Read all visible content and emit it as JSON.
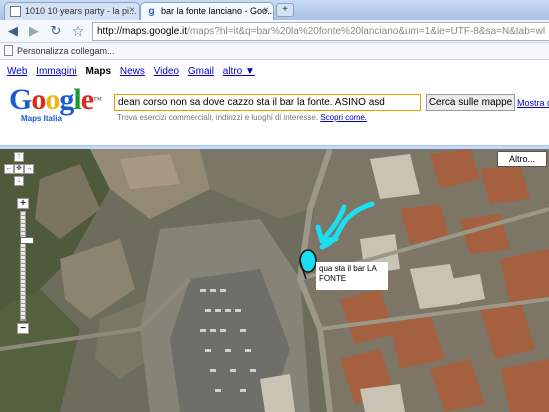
{
  "browser": {
    "tabs": [
      {
        "label": "1010 10 years party - la pi...",
        "active": false
      },
      {
        "label": "bar la fonte lanciano - Goo...",
        "active": true
      }
    ],
    "new_tab_icon": "plus-icon",
    "url_host": "http://maps.google.it",
    "url_rest": "/maps?hl=it&q=bar%20la%20fonte%20lanciano&um=1&ie=UTF-8&sa=N&tab=wl",
    "bookmark": "Personalizza collegam..."
  },
  "google": {
    "nav": {
      "web": "Web",
      "images": "Immagini",
      "maps": "Maps",
      "news": "News",
      "video": "Video",
      "gmail": "Gmail",
      "more": "altro ▼"
    },
    "logo_sub": "Maps Italia",
    "search_value": "dean corso non sa dove cazzo sta il bar la fonte. ASINO asd",
    "search_button": "Cerca sulle mappe",
    "show_options": "Mostra o",
    "hint": "Trova esercizi commerciali, indirizzi e luoghi di interesse.",
    "hint_link": "Scopri come."
  },
  "map": {
    "more_button": "Altro...",
    "annotation": "qua sta il bar LA FONTE",
    "zoom_level": 0.75,
    "colors": {
      "arrow": "#19e0f0",
      "marker": "#19e0f0",
      "annotation_bg": "#ffffff"
    }
  }
}
